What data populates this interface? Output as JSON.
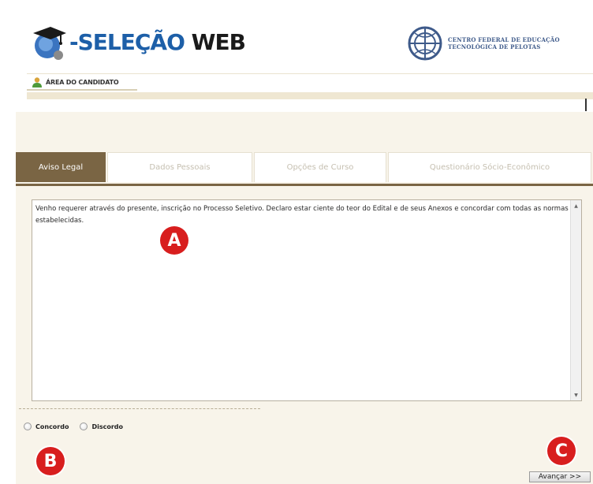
{
  "header": {
    "logo_prefix": "-SELEÇÃO",
    "logo_suffix": "WEB",
    "institution_line1": "CENTRO FEDERAL DE EDUCAÇÃO",
    "institution_line2": "TECNOLÓGICA DE PELOTAS"
  },
  "nav": {
    "area_label": "ÁREA DO CANDIDATO"
  },
  "tabs": [
    {
      "label": "Aviso Legal",
      "active": true
    },
    {
      "label": "Dados Pessoais",
      "active": false
    },
    {
      "label": "Opções de Curso",
      "active": false
    },
    {
      "label": "Questionário Sócio-Econômico",
      "active": false
    }
  ],
  "notice": {
    "text": "Venho requerer através do presente, inscrição no Processo Seletivo. Declaro estar ciente do teor do Edital e de seus Anexos e concordar com todas as normas estabelecidas."
  },
  "options": {
    "agree": "Concordo",
    "disagree": "Discordo"
  },
  "actions": {
    "next": "Avançar >>"
  },
  "annotations": {
    "a": "A",
    "b": "B",
    "c": "C"
  },
  "colors": {
    "brand_blue": "#1d5fa8",
    "tab_active": "#7a6544",
    "panel_bg": "#f8f4ea",
    "badge_red": "#d81e1e"
  }
}
